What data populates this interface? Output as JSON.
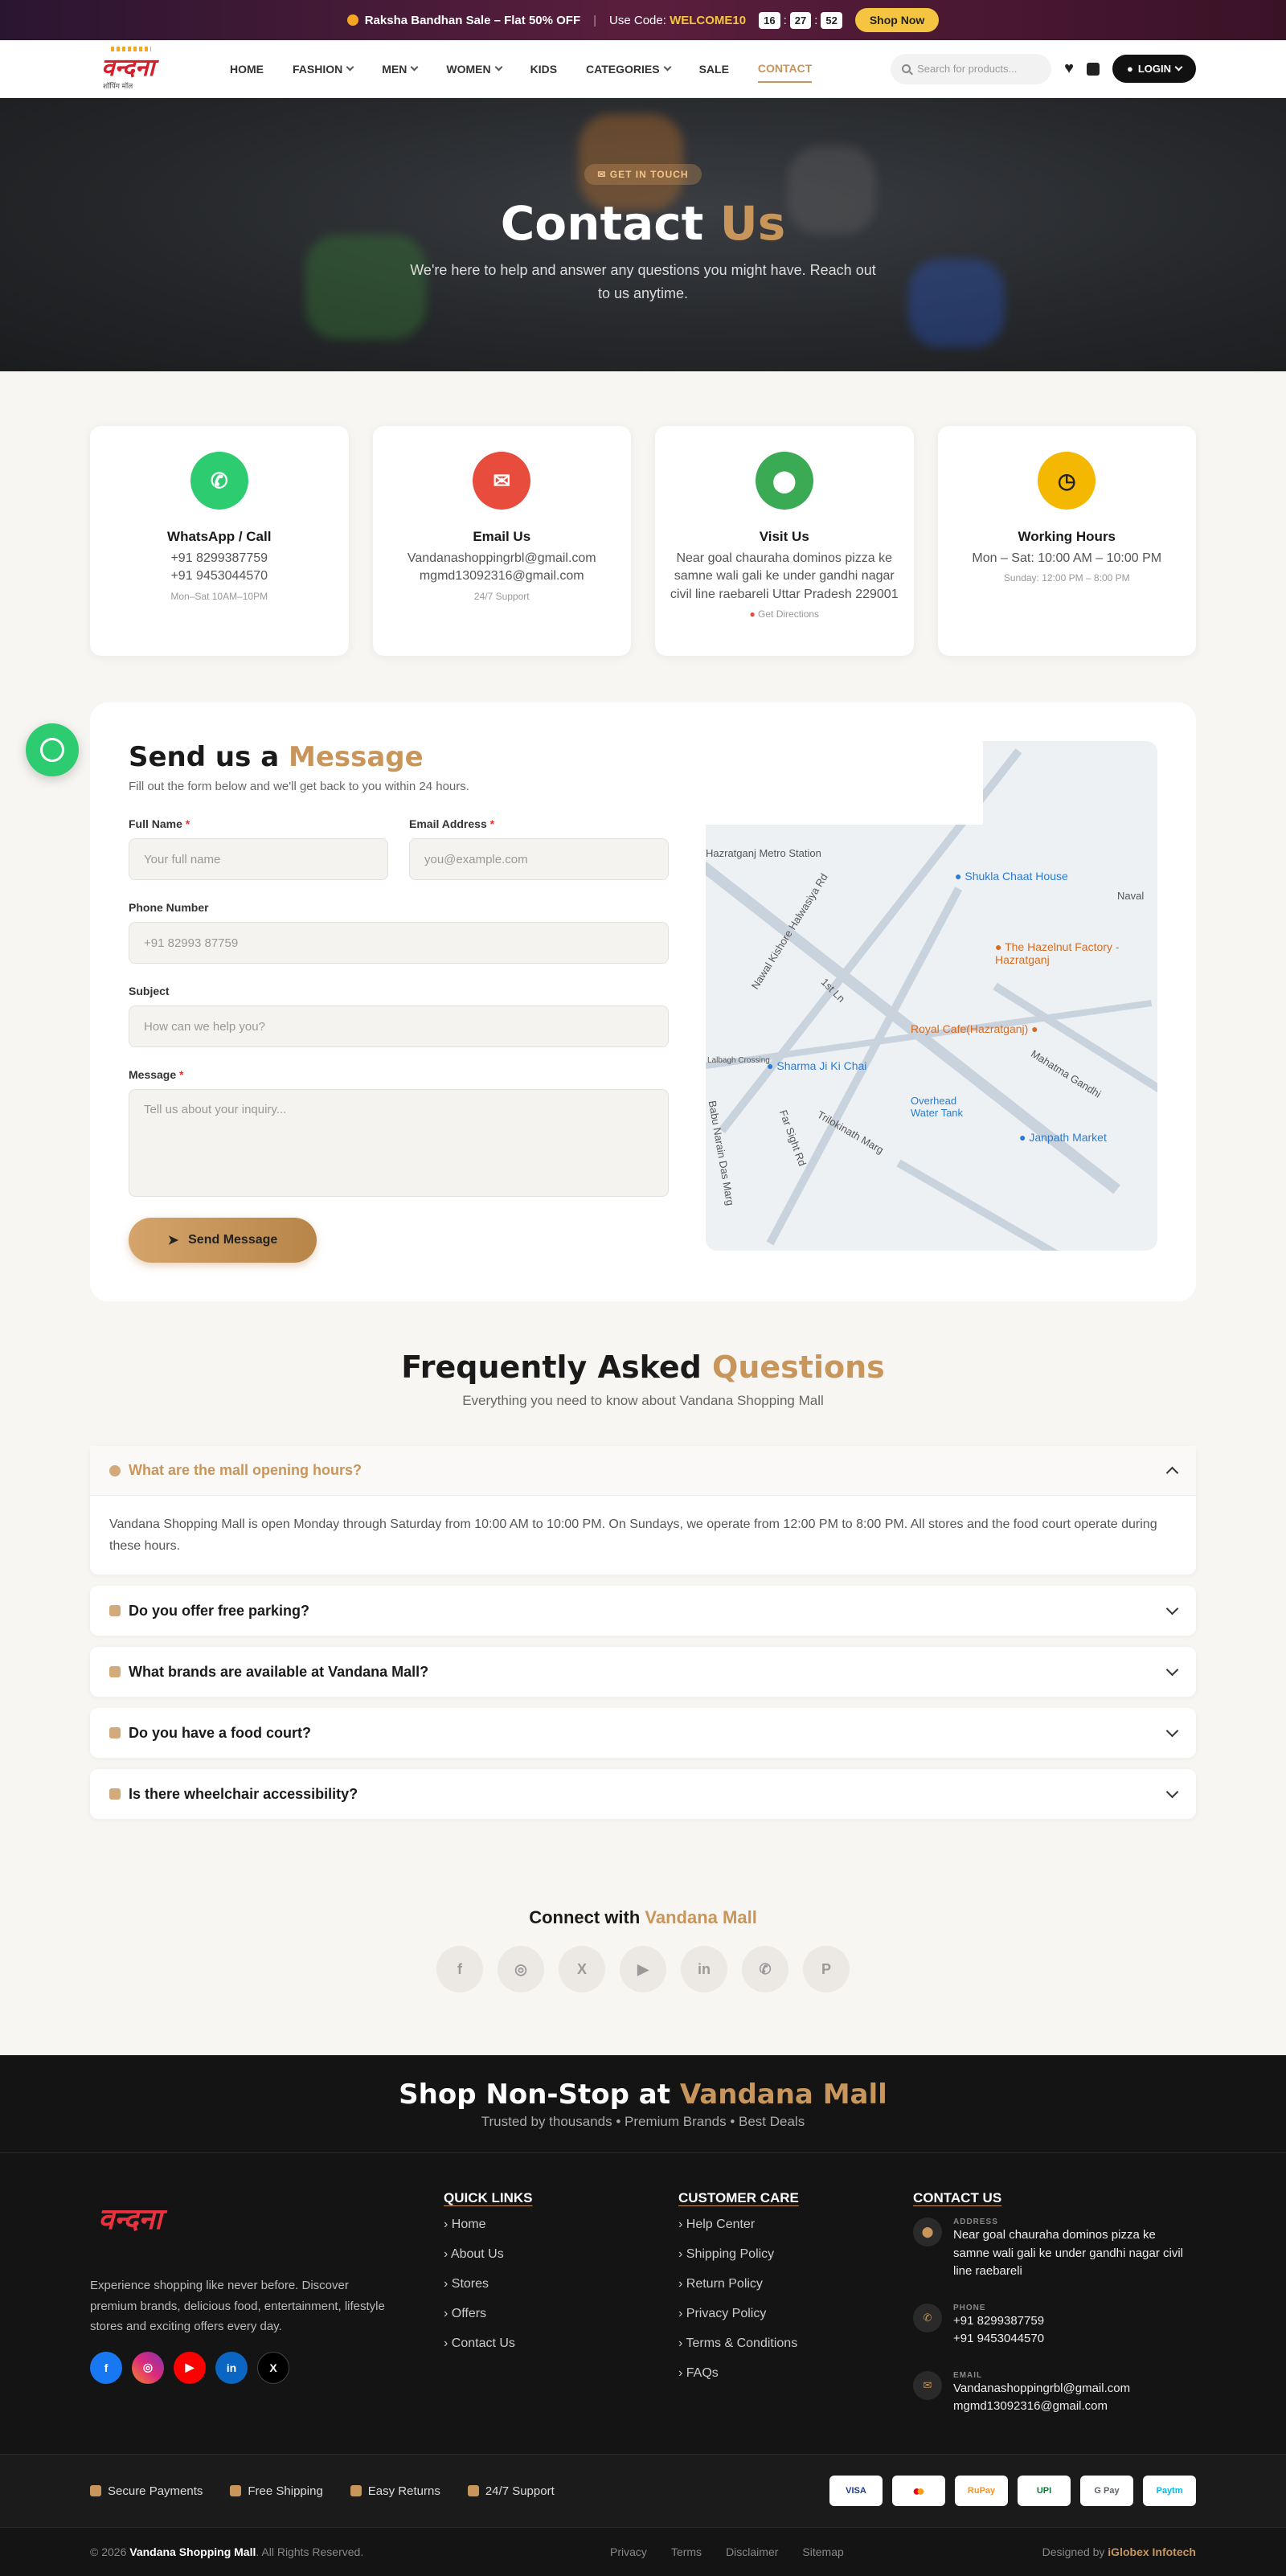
{
  "promo": {
    "sale": "Raksha Bandhan Sale – Flat 50% OFF",
    "code_label": "Use Code:",
    "code": "WELCOME10",
    "timer": [
      "16",
      "27",
      "52"
    ],
    "cta": "Shop Now"
  },
  "nav": {
    "logo_text": "वन्दना",
    "logo_sub": "शॉपिंग मॉल",
    "items": [
      "HOME",
      "FASHION",
      "MEN",
      "WOMEN",
      "KIDS",
      "CATEGORIES",
      "SALE",
      "CONTACT"
    ],
    "search_placeholder": "Search for products...",
    "login": "LOGIN"
  },
  "hero": {
    "pill": "GET IN TOUCH",
    "title_a": "Contact",
    "title_b": "Us",
    "subtitle": "We're here to help and answer any questions you might have. Reach out to us anytime."
  },
  "cards": [
    {
      "title": "WhatsApp / Call",
      "lines": [
        "+91 8299387759",
        "+91 9453044570"
      ],
      "small": "Mon–Sat 10AM–10PM",
      "color": "#2ecc71"
    },
    {
      "title": "Email Us",
      "lines": [
        "Vandanashoppingrbl@gmail.com",
        "mgmd13092316@gmail.com"
      ],
      "small": "24/7 Support",
      "color": "#e74c3c"
    },
    {
      "title": "Visit Us",
      "lines": [
        "Near goal chauraha dominos pizza ke samne wali gali ke under gandhi nagar civil line raebareli Uttar Pradesh 229001"
      ],
      "small": "Get Directions",
      "color": "#3aaa55"
    },
    {
      "title": "Working Hours",
      "lines": [
        "Mon – Sat: 10:00 AM – 10:00 PM"
      ],
      "small": "Sunday: 12:00 PM – 8:00 PM",
      "color": "#f5b800"
    }
  ],
  "form": {
    "title_a": "Send us a",
    "title_b": "Message",
    "subtitle": "Fill out the form below and we'll get back to you within 24 hours.",
    "full_name_label": "Full Name",
    "full_name_ph": "Your full name",
    "email_label": "Email Address",
    "email_ph": "you@example.com",
    "phone_label": "Phone Number",
    "phone_ph": "+91 82993 87759",
    "subject_label": "Subject",
    "subject_ph": "How can we help you?",
    "message_label": "Message",
    "message_ph": "Tell us about your inquiry...",
    "send": "Send Message",
    "required_mark": "*"
  },
  "map": {
    "labels": [
      "Hazratganj Metro Station",
      "Shukla Chaat House",
      "The Hazelnut Factory - Hazratganj",
      "Royal Cafe(Hazratganj)",
      "Sharma Ji Ki Chai",
      "Janpath Market",
      "Nawal Kishore Halwasiya Rd",
      "Trilokinath Marg",
      "Mahatma Gandhi",
      "Overhead Water Tank",
      "Babu Narain Das Marg",
      "Lalbagh Crossing",
      "Naval",
      "1st Ln",
      "Far Sight Rd"
    ]
  },
  "faq": {
    "title_a": "Frequently Asked",
    "title_b": "Questions",
    "subtitle": "Everything you need to know about Vandana Shopping Mall",
    "items": [
      {
        "q": "What are the mall opening hours?",
        "a": "Vandana Shopping Mall is open Monday through Saturday from 10:00 AM to 10:00 PM. On Sundays, we operate from 12:00 PM to 8:00 PM. All stores and the food court operate during these hours."
      },
      {
        "q": "Do you offer free parking?"
      },
      {
        "q": "What brands are available at Vandana Mall?"
      },
      {
        "q": "Do you have a food court?"
      },
      {
        "q": "Is there wheelchair accessibility?"
      }
    ]
  },
  "connect": {
    "title_a": "Connect with",
    "title_b": "Vandana Mall",
    "icons": [
      "facebook-icon",
      "instagram-icon",
      "x-icon",
      "youtube-icon",
      "linkedin-icon",
      "whatsapp-icon",
      "pinterest-icon"
    ],
    "glyphs": [
      "f",
      "◎",
      "X",
      "▶",
      "in",
      "✆",
      "P"
    ]
  },
  "footer": {
    "banner_a": "Shop Non-Stop at",
    "banner_b": "Vandana Mall",
    "banner_sub": "Trusted by thousands • Premium Brands • Best Deals",
    "about": "Experience shopping like never before. Discover premium brands, delicious food, entertainment, lifestyle stores and exciting offers every day.",
    "quick_title": "QUICK LINKS",
    "quick": [
      "Home",
      "About Us",
      "Stores",
      "Offers",
      "Contact Us"
    ],
    "care_title": "CUSTOMER CARE",
    "care": [
      "Help Center",
      "Shipping Policy",
      "Return Policy",
      "Privacy Policy",
      "Terms & Conditions",
      "FAQs"
    ],
    "contact_title": "CONTACT US",
    "address_label": "ADDRESS",
    "address": "Near goal chauraha dominos pizza ke samne wali gali ke under gandhi nagar civil line raebareli",
    "phone_label": "PHONE",
    "phones": [
      "+91 8299387759",
      "+91 9453044570"
    ],
    "email_label": "EMAIL",
    "emails": [
      "Vandanashoppingrbl@gmail.com",
      "mgmd13092316@gmail.com"
    ],
    "trust": [
      "Secure Payments",
      "Free Shipping",
      "Easy Returns",
      "24/7 Support"
    ],
    "payments": [
      "VISA",
      "Mastercard",
      "RuPay",
      "UPI",
      "G Pay",
      "Paytm"
    ],
    "copyright_a": "© 2026",
    "copyright_b": "Vandana Shopping Mall",
    "copyright_c": ". All Rights Reserved.",
    "bottom_links": [
      "Privacy",
      "Terms",
      "Disclaimer",
      "Sitemap"
    ],
    "designed_by_label": "Designed by",
    "designed_by": "iGlobex Infotech"
  }
}
